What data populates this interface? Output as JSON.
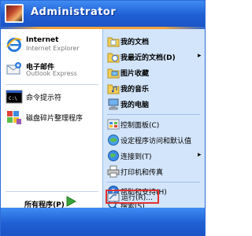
{
  "header": {
    "user_name": "Administrator"
  },
  "pinned": [
    {
      "title": "Internet",
      "subtitle": "Internet Explorer",
      "icon": "internet-explorer-icon"
    },
    {
      "title": "电子邮件",
      "subtitle": "Outlook Express",
      "icon": "outlook-express-icon"
    }
  ],
  "recent": [
    {
      "label": "命令提示符",
      "icon": "command-prompt-icon"
    },
    {
      "label": "磁盘碎片整理程序",
      "icon": "disk-defragmenter-icon"
    }
  ],
  "all_programs": {
    "label": "所有程序(P)"
  },
  "places": [
    {
      "label": "我的文档",
      "icon": "my-documents-icon"
    },
    {
      "label": "我最近的文档(D)",
      "icon": "recent-documents-icon",
      "arrow": "▸"
    },
    {
      "label": "图片收藏",
      "icon": "my-pictures-icon"
    },
    {
      "label": "我的音乐",
      "icon": "my-music-icon"
    },
    {
      "label": "我的电脑",
      "icon": "my-computer-icon"
    },
    {
      "label": "控制面板(C)",
      "icon": "control-panel-icon"
    },
    {
      "label": "设定程序访问和默认值",
      "icon": "program-access-icon"
    },
    {
      "label": "连接到(T)",
      "icon": "connect-to-icon",
      "arrow": "▸"
    },
    {
      "label": "打印机和传真",
      "icon": "printers-faxes-icon"
    },
    {
      "label": "帮助和支持(H)",
      "icon": "help-support-icon"
    },
    {
      "label": "搜索(S)",
      "icon": "search-icon"
    },
    {
      "label": "运行(R)...",
      "icon": "run-icon"
    }
  ]
}
